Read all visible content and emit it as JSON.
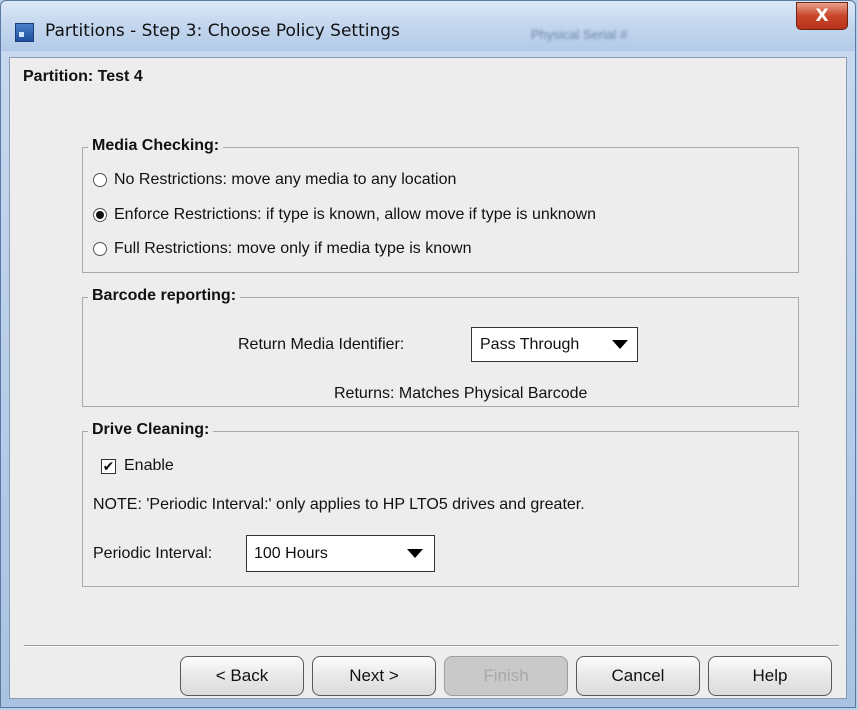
{
  "window": {
    "title": "Partitions - Step 3: Choose Policy Settings",
    "background_text_1": "Physical Serial #",
    "close_symbol": "X"
  },
  "partition_label": "Partition: Test 4",
  "media_checking": {
    "legend": "Media Checking:",
    "options": [
      {
        "label": "No Restrictions: move any media to any location",
        "checked": false
      },
      {
        "label": "Enforce Restrictions: if type is known, allow move if type is unknown",
        "checked": true
      },
      {
        "label": "Full Restrictions: move only if media type is known",
        "checked": false
      }
    ]
  },
  "barcode_reporting": {
    "legend": "Barcode reporting:",
    "field_label": "Return Media Identifier:",
    "selected": "Pass Through",
    "returns_text": "Returns: Matches Physical Barcode"
  },
  "drive_cleaning": {
    "legend": "Drive Cleaning:",
    "enable_label": "Enable",
    "enable_checked": true,
    "check_symbol": "✔",
    "note": "NOTE: 'Periodic Interval:' only applies to HP LTO5 drives and greater.",
    "interval_label": "Periodic Interval:",
    "interval_selected": "100 Hours"
  },
  "buttons": {
    "back": "< Back",
    "next": "Next >",
    "finish": "Finish",
    "cancel": "Cancel",
    "help": "Help"
  }
}
